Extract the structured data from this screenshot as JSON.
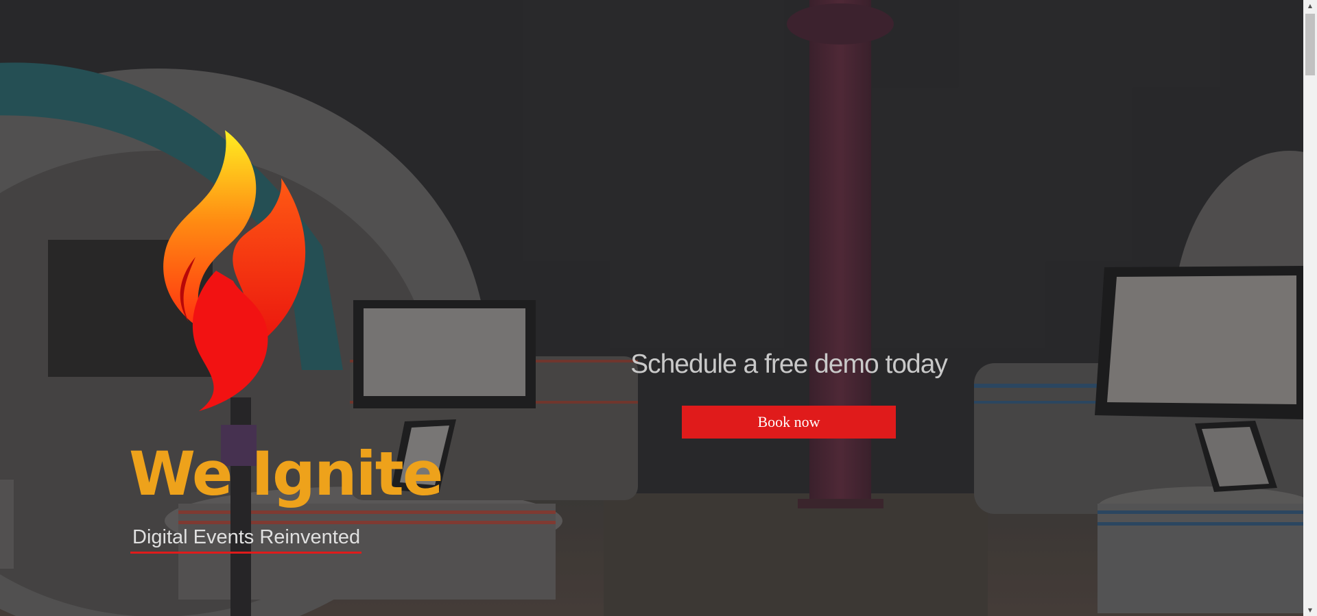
{
  "colors": {
    "brand_orange": "#eea21b",
    "accent_red": "#e01b1b",
    "tagline_text": "#e0e0e0",
    "heading_text": "#c9c9c9",
    "button_text": "#ffffff"
  },
  "hero": {
    "logo_icon": "flame-icon",
    "title": "We Ignite",
    "tagline": "Digital Events Reinvented"
  },
  "cta": {
    "heading": "Schedule a free demo today",
    "button_label": "Book now"
  },
  "scrollbar": {
    "up_icon": "▲",
    "down_icon": "▼"
  }
}
